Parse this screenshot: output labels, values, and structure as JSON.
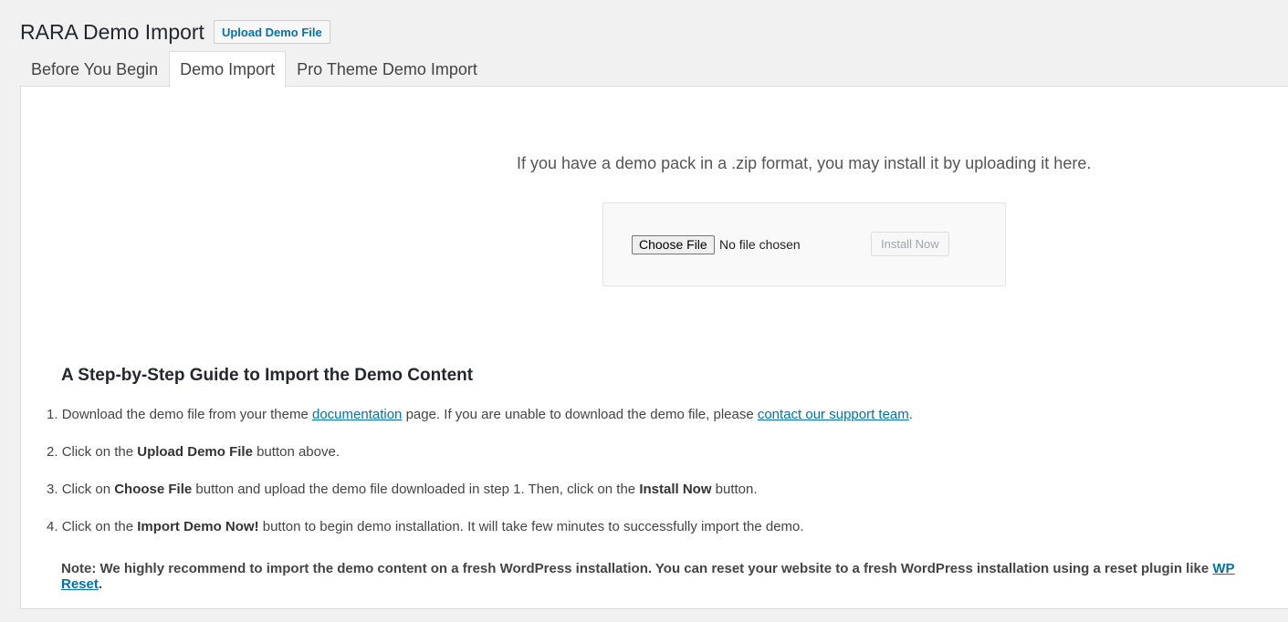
{
  "header": {
    "title": "RARA Demo Import",
    "upload_button": "Upload Demo File"
  },
  "tabs": [
    {
      "label": "Before You Begin",
      "active": false
    },
    {
      "label": "Demo Import",
      "active": true
    },
    {
      "label": "Pro Theme Demo Import",
      "active": false
    }
  ],
  "upload": {
    "intro": "If you have a demo pack in a .zip format, you may install it by uploading it here.",
    "choose_file": "Choose File",
    "no_file": "No file chosen",
    "install_now": "Install Now"
  },
  "guide": {
    "title": "A Step-by-Step Guide to Import the Demo Content",
    "steps": [
      {
        "num": "1.",
        "t1": "Download the demo file from your theme ",
        "link1": "documentation",
        "t2": " page. If you are unable to download the demo file, please ",
        "link2": "contact our support team",
        "t3": "."
      },
      {
        "num": "2.",
        "t1": "Click on the ",
        "b1": "Upload Demo File",
        "t2": " button above."
      },
      {
        "num": "3.",
        "t1": "Click on ",
        "b1": "Choose File",
        "t2": " button and upload the demo file downloaded in step 1. Then, click on the ",
        "b2": "Install Now",
        "t3": " button."
      },
      {
        "num": "4.",
        "t1": "Click on the ",
        "b1": "Import Demo Now!",
        "t2": " button to begin demo installation. It will take few minutes to successfully import the demo."
      }
    ],
    "note": {
      "text": "Note: We highly recommend to import the demo content on a fresh WordPress installation. You can reset your website to a fresh WordPress installation using a reset plugin like ",
      "link": "WP Reset",
      "end": "."
    }
  },
  "colors": {
    "link": "#0073aa",
    "background": "#f1f1f1",
    "panel": "#ffffff"
  }
}
